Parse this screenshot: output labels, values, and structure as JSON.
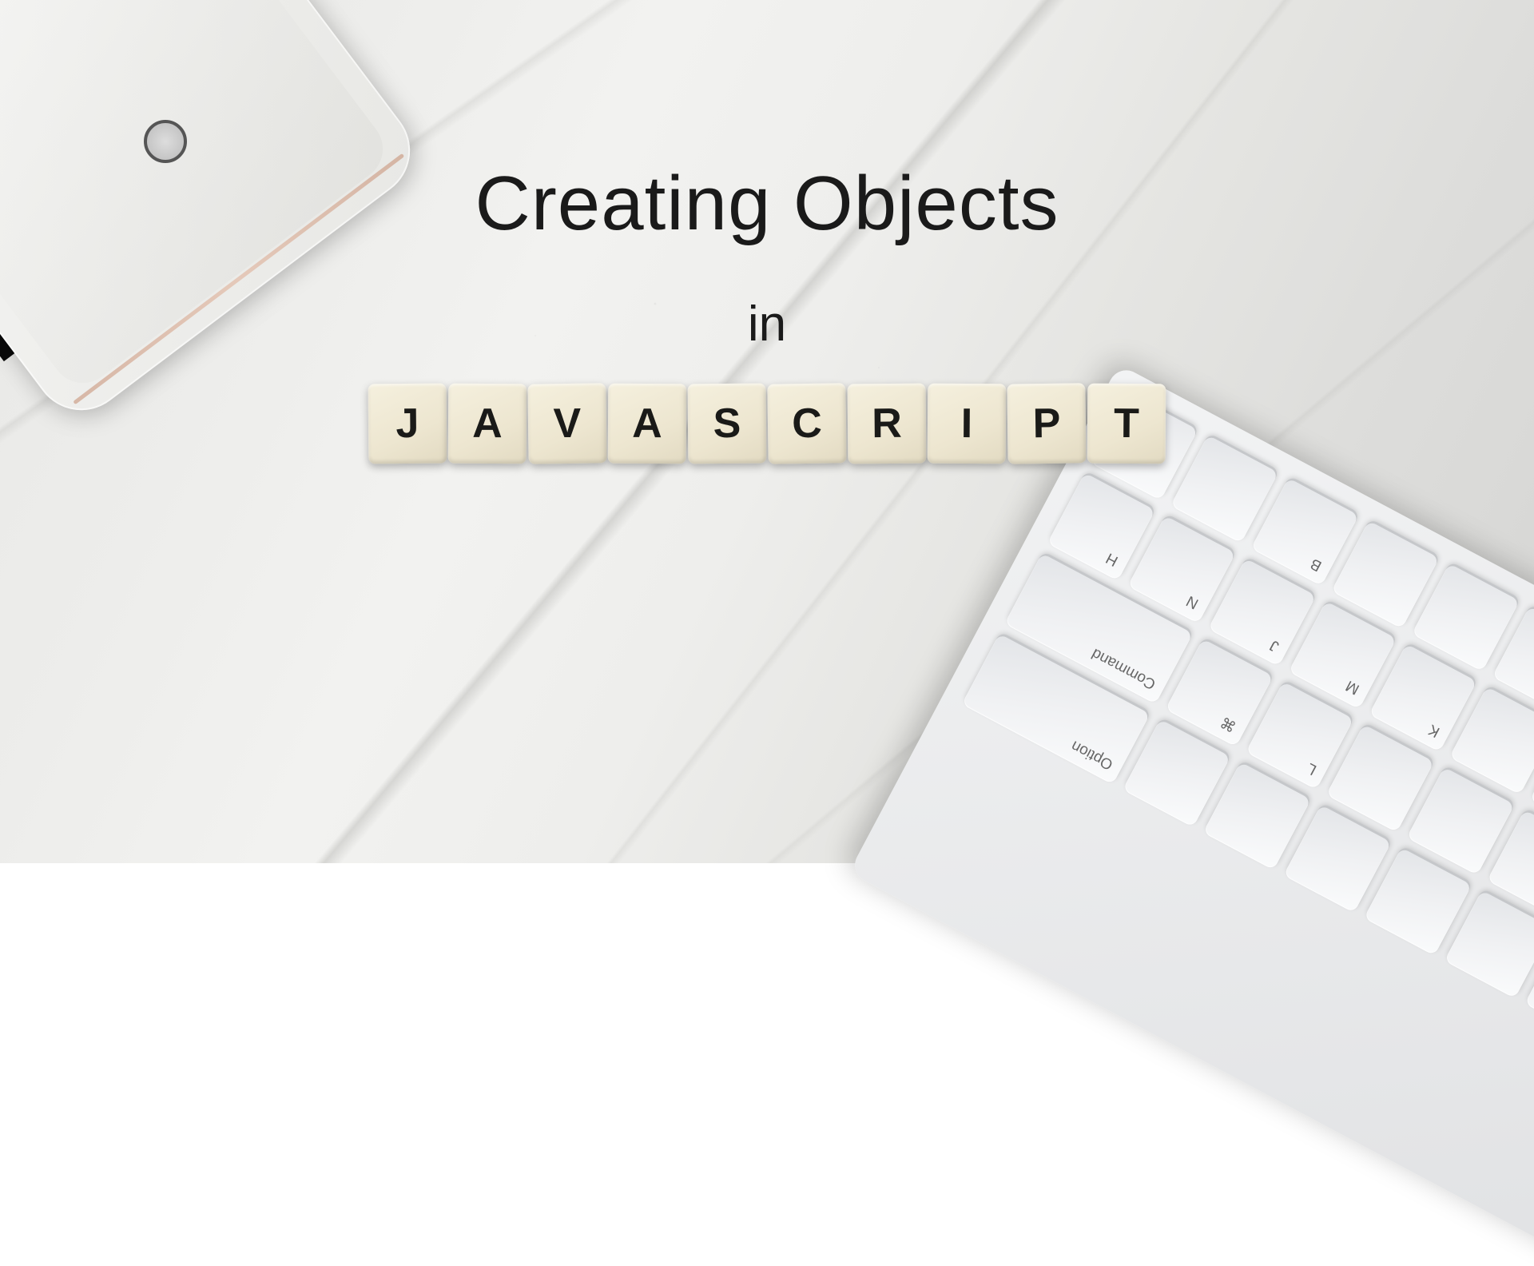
{
  "heading": {
    "line1": "Creating Objects",
    "line2": "in"
  },
  "tiles": {
    "letters": [
      "J",
      "A",
      "V",
      "A",
      "S",
      "C",
      "R",
      "I",
      "P",
      "T"
    ]
  },
  "keyboard": {
    "visible_keys": [
      "B",
      "H",
      "N",
      "J",
      "M",
      "K",
      "Command",
      "⌘",
      "L",
      "Option"
    ]
  },
  "scene": {
    "surface": "white marble",
    "tablet_color": "silver",
    "accent_edge": "rose-gold"
  }
}
